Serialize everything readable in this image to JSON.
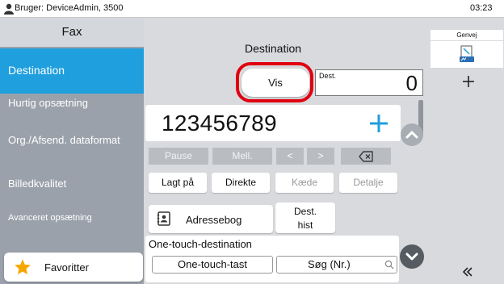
{
  "status_bar": {
    "user": "Bruger: DeviceAdmin, 3500",
    "time": "03:23"
  },
  "sidebar": {
    "header": "Fax",
    "items": [
      {
        "label": "Destination",
        "active": true
      },
      {
        "label": "Hurtig opsætning"
      },
      {
        "label": "Org./Afsend. dataformat"
      },
      {
        "label": "Billedkvalitet"
      },
      {
        "label": "Avanceret opsætning"
      }
    ],
    "favorites": "Favoritter"
  },
  "destination": {
    "title": "Destination",
    "view_button": "Vis",
    "count_label": "Dest.",
    "count": "0",
    "number": "123456789"
  },
  "keys": {
    "pause": "Pause",
    "space": "Mell.",
    "left": "<",
    "right": ">"
  },
  "actions": {
    "on_hook": "Lagt på",
    "direct": "Direkte",
    "chain": "Kæde",
    "detail": "Detalje"
  },
  "address_book": "Adressebog",
  "dest_history": {
    "line1": "Dest.",
    "line2": "hist"
  },
  "one_touch": {
    "title": "One-touch-destination",
    "key": "One-touch-tast",
    "search": "Søg (Nr.)"
  },
  "shortcut": {
    "label": "Genvej"
  },
  "icons": [
    "user-icon",
    "star-icon",
    "plus-icon",
    "backspace-icon",
    "book-icon",
    "search-icon",
    "shortcut-icon",
    "chevron-up-icon",
    "chevron-down-icon",
    "double-chevron-left-icon"
  ],
  "colors": {
    "accent": "#1f9fde",
    "highlight_ring": "#e00010",
    "sidebar": "#9aa1aa",
    "panel": "#d8dadd"
  }
}
